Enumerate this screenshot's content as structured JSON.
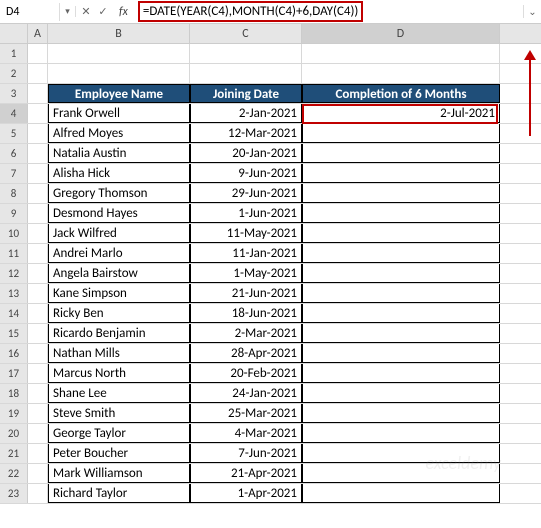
{
  "name_box": "D4",
  "formula": "=DATE(YEAR(C4),MONTH(C4)+6,DAY(C4))",
  "columns": {
    "A": "A",
    "B": "B",
    "C": "C",
    "D": "D"
  },
  "headers": {
    "employee": "Employee Name",
    "joining": "Joining Date",
    "completion": "Completion of 6 Months"
  },
  "result_cell": "2-Jul-2021",
  "rows": [
    {
      "n": "1"
    },
    {
      "n": "2"
    },
    {
      "n": "3",
      "header": true
    },
    {
      "n": "4",
      "emp": "Frank Orwell",
      "date": "2-Jan-2021",
      "comp": "2-Jul-2021",
      "selected": true
    },
    {
      "n": "5",
      "emp": "Alfred Moyes",
      "date": "12-Mar-2021",
      "comp": ""
    },
    {
      "n": "6",
      "emp": "Natalia Austin",
      "date": "20-Jan-2021",
      "comp": ""
    },
    {
      "n": "7",
      "emp": "Alisha Hick",
      "date": "9-Jun-2021",
      "comp": ""
    },
    {
      "n": "8",
      "emp": "Gregory Thomson",
      "date": "29-Jun-2021",
      "comp": ""
    },
    {
      "n": "9",
      "emp": "Desmond Hayes",
      "date": "1-Jun-2021",
      "comp": ""
    },
    {
      "n": "10",
      "emp": "Jack Wilfred",
      "date": "11-May-2021",
      "comp": ""
    },
    {
      "n": "11",
      "emp": "Andrei Marlo",
      "date": "11-Jan-2021",
      "comp": ""
    },
    {
      "n": "12",
      "emp": "Angela Bairstow",
      "date": "1-May-2021",
      "comp": ""
    },
    {
      "n": "13",
      "emp": "Kane Simpson",
      "date": "21-Jun-2021",
      "comp": ""
    },
    {
      "n": "14",
      "emp": "Ricky Ben",
      "date": "18-Jun-2021",
      "comp": ""
    },
    {
      "n": "15",
      "emp": "Ricardo Benjamin",
      "date": "2-Mar-2021",
      "comp": ""
    },
    {
      "n": "16",
      "emp": "Nathan Mills",
      "date": "28-Apr-2021",
      "comp": ""
    },
    {
      "n": "17",
      "emp": "Marcus North",
      "date": "20-Feb-2021",
      "comp": ""
    },
    {
      "n": "18",
      "emp": "Shane Lee",
      "date": "24-Jan-2021",
      "comp": ""
    },
    {
      "n": "19",
      "emp": "Steve Smith",
      "date": "25-Mar-2021",
      "comp": ""
    },
    {
      "n": "20",
      "emp": "George Taylor",
      "date": "4-Mar-2021",
      "comp": ""
    },
    {
      "n": "21",
      "emp": "Peter Boucher",
      "date": "7-Jun-2021",
      "comp": ""
    },
    {
      "n": "22",
      "emp": "Mark Williamson",
      "date": "21-Apr-2021",
      "comp": ""
    },
    {
      "n": "23",
      "emp": "Richard Taylor",
      "date": "1-Apr-2021",
      "comp": ""
    }
  ],
  "fx_label": "fx",
  "watermark": "exceldemy"
}
